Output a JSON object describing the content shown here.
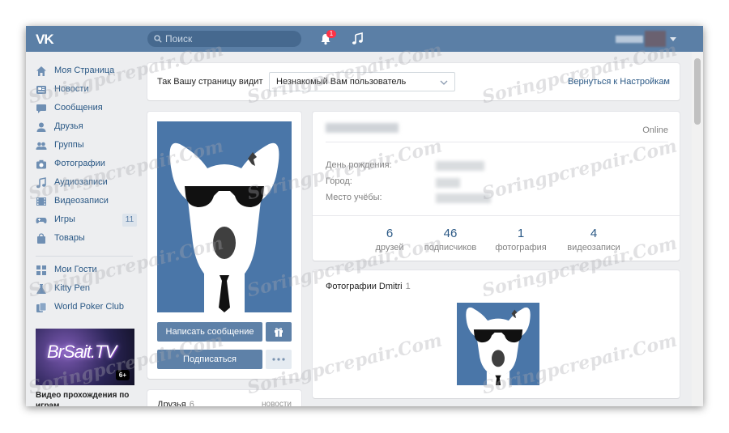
{
  "header": {
    "logo": "VK",
    "search_placeholder": "Поиск",
    "notifications_count": "1"
  },
  "sidebar": {
    "items": [
      {
        "label": "Моя Страница",
        "icon": "home-icon"
      },
      {
        "label": "Новости",
        "icon": "news-icon"
      },
      {
        "label": "Сообщения",
        "icon": "messages-icon"
      },
      {
        "label": "Друзья",
        "icon": "friend-icon"
      },
      {
        "label": "Группы",
        "icon": "groups-icon"
      },
      {
        "label": "Фотографии",
        "icon": "camera-icon"
      },
      {
        "label": "Аудиозаписи",
        "icon": "music-note-icon"
      },
      {
        "label": "Видеозаписи",
        "icon": "video-icon"
      },
      {
        "label": "Игры",
        "icon": "gamepad-icon",
        "count": "11"
      },
      {
        "label": "Товары",
        "icon": "shopping-bag-icon"
      }
    ],
    "apps": [
      {
        "label": "Мои Гости",
        "icon": "grid-icon"
      },
      {
        "label": "Kitty Pen",
        "icon": "flask-icon"
      },
      {
        "label": "World Poker Club",
        "icon": "cards-icon"
      }
    ],
    "ad": {
      "title": "BrSait.TV",
      "age": "6+",
      "caption": "Видео прохождения по играм."
    }
  },
  "view_bar": {
    "label": "Так Вашу страницу видит",
    "selected": "Незнакомый Вам пользователь",
    "back_link": "Вернуться к Настройкам"
  },
  "profile": {
    "status": "Online",
    "fields": [
      {
        "label": "День рождения:"
      },
      {
        "label": "Город:"
      },
      {
        "label": "Место учёбы:"
      }
    ],
    "stats": [
      {
        "num": "6",
        "label": "друзей"
      },
      {
        "num": "46",
        "label": "подписчиков"
      },
      {
        "num": "1",
        "label": "фотография"
      },
      {
        "num": "4",
        "label": "видеозаписи"
      }
    ]
  },
  "actions": {
    "message": "Написать сообщение",
    "subscribe": "Подписаться"
  },
  "photos": {
    "title": "Фотографии Dmitri",
    "count": "1"
  },
  "friends": {
    "title": "Друзья",
    "count": "6",
    "news": "новости"
  },
  "watermark": "Soringpcrepair.Com",
  "colors": {
    "header": "#5b7fa6",
    "link": "#2a5885",
    "background": "#edeef0",
    "button": "#5e81a8",
    "avatar_bg": "#4a76a8"
  }
}
